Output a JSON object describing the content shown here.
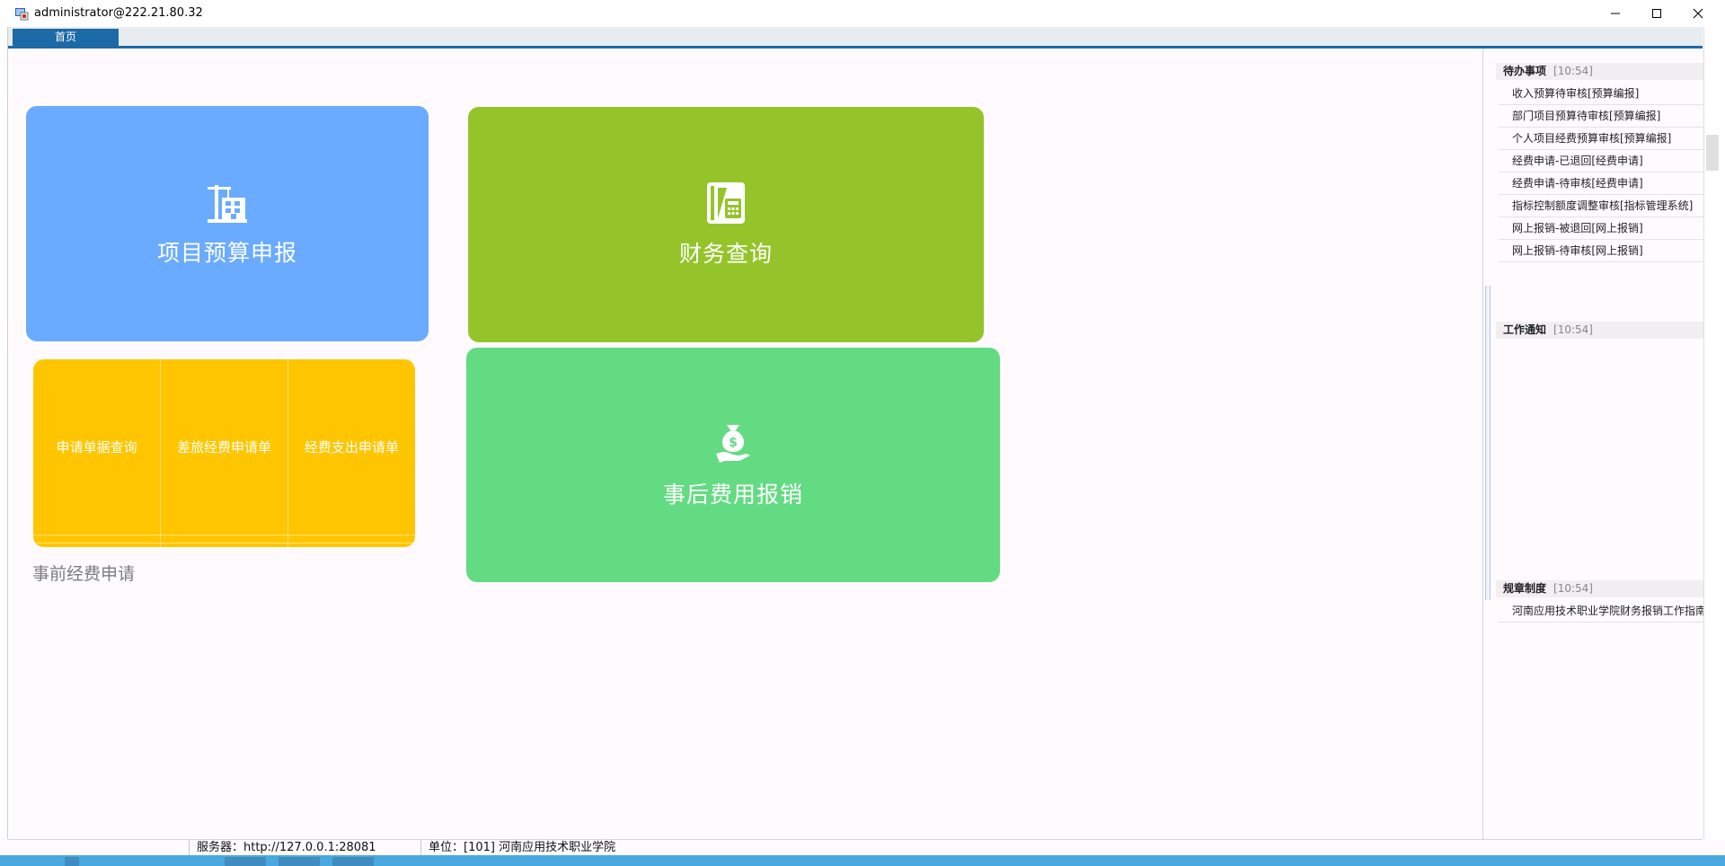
{
  "window": {
    "title": "administrator@222.21.80.32"
  },
  "tabs": {
    "home_label": "首页"
  },
  "tiles": {
    "budget_label": "项目预算申报",
    "finance_label": "财务查询",
    "reimbursement_label": "事后费用报销"
  },
  "pre_application": {
    "grid": [
      [
        "申请单据查询",
        "差旅经费申请单",
        "经费支出申请单"
      ],
      [
        "",
        "",
        ""
      ],
      [
        "",
        "",
        ""
      ]
    ],
    "caption": "事前经费申请"
  },
  "panel": {
    "todo": {
      "title": "待办事项",
      "time": "[10:54]",
      "items": [
        "收入预算待审核[预算编报]",
        "部门项目预算待审核[预算编报]",
        "个人项目经费预算审核[预算编报]",
        "经费申请-已退回[经费申请]",
        "经费申请-待审核[经费申请]",
        "指标控制额度调整审核[指标管理系统]",
        "网上报销-被退回[网上报销]",
        "网上报销-待审核[网上报销]"
      ]
    },
    "notice": {
      "title": "工作通知",
      "time": "[10:54]"
    },
    "rules": {
      "title": "规章制度",
      "time": "[10:54]",
      "items": [
        "河南应用技术职业学院财务报销工作指南"
      ]
    }
  },
  "status": {
    "server": "服务器：http://127.0.0.1:28081",
    "unit": "单位：[101] 河南应用技术职业学院"
  },
  "colors": {
    "budget_tile": "#6aabff",
    "finance_tile": "#94c42a",
    "reimbursement_tile": "#63db82",
    "pre_application_card": "#ffc600",
    "tab_active": "#1c6aa8"
  }
}
